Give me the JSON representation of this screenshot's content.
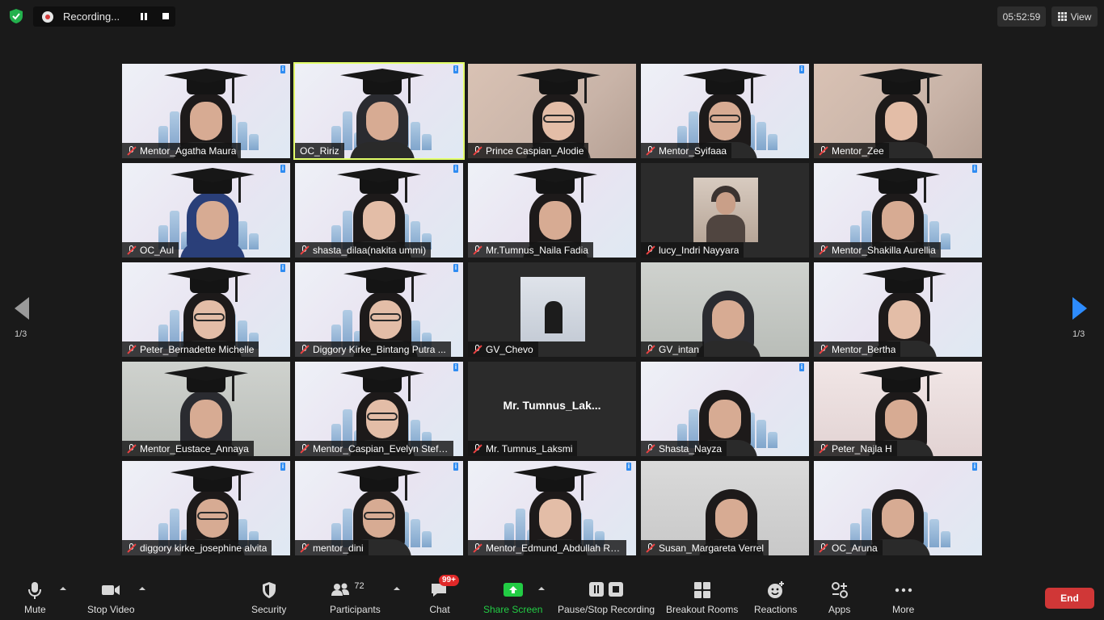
{
  "topbar": {
    "recording_label": "Recording...",
    "timer": "05:52:59",
    "view_label": "View"
  },
  "pagination": {
    "left_page": "1/3",
    "right_page": "1/3"
  },
  "participants": [
    {
      "name": "Mentor_Agatha Maura",
      "video": true,
      "muted": true
    },
    {
      "name": "OC_Ririz",
      "video": true,
      "muted": false,
      "speaking": true
    },
    {
      "name": "Prince Caspian_Alodie",
      "video": true,
      "muted": true
    },
    {
      "name": "Mentor_Syifaaa",
      "video": true,
      "muted": true
    },
    {
      "name": "Mentor_Zee",
      "video": true,
      "muted": true
    },
    {
      "name": "OC_Aul",
      "video": true,
      "muted": true
    },
    {
      "name": "shasta_dilaa(nakita ummi)",
      "video": true,
      "muted": true
    },
    {
      "name": "Mr.Tumnus_Naila Fadia",
      "video": true,
      "muted": true
    },
    {
      "name": "lucy_Indri Nayyara",
      "video": false,
      "avatar": "photo",
      "muted": true
    },
    {
      "name": "Mentor_Shakilla Aurellia",
      "video": true,
      "muted": true
    },
    {
      "name": "Peter_Bernadette Michelle",
      "video": true,
      "muted": true
    },
    {
      "name": "Diggory Kirke_Bintang Putra ...",
      "video": true,
      "muted": true
    },
    {
      "name": "GV_Chevo",
      "video": false,
      "avatar": "silhouette",
      "muted": true
    },
    {
      "name": "GV_intan",
      "video": true,
      "muted": true
    },
    {
      "name": "Mentor_Bertha",
      "video": true,
      "muted": true
    },
    {
      "name": "Mentor_Eustace_Annaya",
      "video": true,
      "muted": true
    },
    {
      "name": "Mentor_Caspian_Evelyn Stefili...",
      "video": true,
      "muted": true
    },
    {
      "name": "Mr. Tumnus_Laksmi",
      "video": false,
      "display_name": "Mr.  Tumnus_Lak...",
      "muted": true
    },
    {
      "name": "Shasta_Nayza",
      "video": true,
      "muted": true
    },
    {
      "name": "Peter_Najla H",
      "video": true,
      "muted": true
    },
    {
      "name": "diggory kirke_josephine alvita",
      "video": true,
      "muted": true
    },
    {
      "name": "mentor_dini",
      "video": true,
      "muted": true
    },
    {
      "name": "Mentor_Edmund_Abdullah Ra...",
      "video": true,
      "muted": true
    },
    {
      "name": "Susan_Margareta Verrel",
      "video": true,
      "muted": true
    },
    {
      "name": "OC_Aruna",
      "video": true,
      "muted": true
    }
  ],
  "toolbar": {
    "mute": "Mute",
    "stop_video": "Stop Video",
    "security": "Security",
    "participants": "Participants",
    "participants_count": "72",
    "chat": "Chat",
    "chat_badge": "99+",
    "share_screen": "Share Screen",
    "pause_stop_recording": "Pause/Stop Recording",
    "breakout_rooms": "Breakout Rooms",
    "reactions": "Reactions",
    "apps": "Apps",
    "more": "More",
    "end": "End"
  },
  "colors": {
    "background": "#1a1a1a",
    "speaking_border": "#e3ff6a",
    "muted_icon": "#ef4343",
    "share_green": "#22cc44",
    "end_red": "#d03737",
    "accent_blue": "#2d8cff"
  }
}
